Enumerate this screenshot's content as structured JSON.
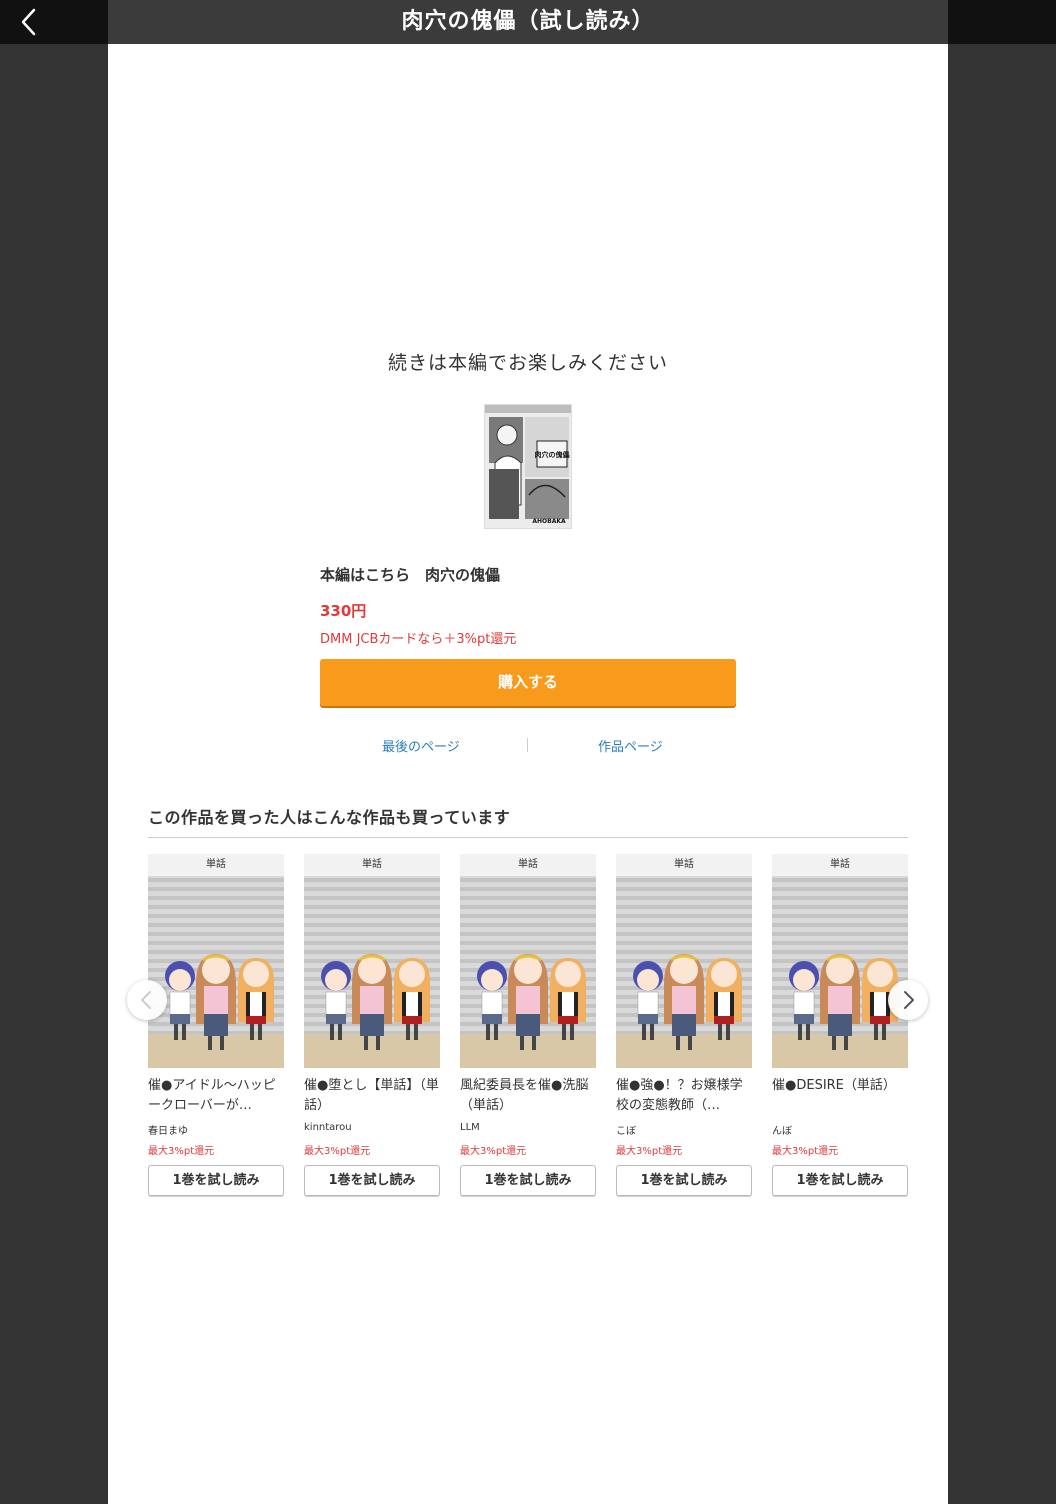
{
  "header": {
    "title": "肉穴の傀儡（試し読み）",
    "back_icon": "chevron-left-icon"
  },
  "main": {
    "continue_message": "続きは本編でお楽しみください",
    "cover_credit": "AHOBAKA",
    "cover_title_text": "肉穴の傀儡",
    "buy_title": "本編はこちら　肉穴の傀儡",
    "price": "330円",
    "jcb_note": "DMM JCBカードなら＋3%pt還元",
    "buy_button": "購入する",
    "last_page_link": "最後のページ",
    "work_page_link": "作品ページ"
  },
  "recommendations": {
    "heading": "この作品を買った人はこんな作品も買っています",
    "items": [
      {
        "tag": "単話",
        "title": "催●アイドル〜ハッピークローバーが…",
        "author": "春日まゆ",
        "points": "最大3%pt還元",
        "button": "1巻を試し読み"
      },
      {
        "tag": "単話",
        "title": "催●堕とし【単話】（単話）",
        "author": "kinntarou",
        "points": "最大3%pt還元",
        "button": "1巻を試し読み"
      },
      {
        "tag": "単話",
        "title": "風紀委員長を催●洗脳（単話）",
        "author": "LLM",
        "points": "最大3%pt還元",
        "button": "1巻を試し読み"
      },
      {
        "tag": "単話",
        "title": "催●強●！？お嬢様学校の変態教師（…",
        "author": "こぼ",
        "points": "最大3%pt還元",
        "button": "1巻を試し読み"
      },
      {
        "tag": "単話",
        "title": "催●DESIRE（単話）",
        "author": "んぼ",
        "points": "最大3%pt還元",
        "button": "1巻を試し読み"
      }
    ],
    "prev_icon": "chevron-left-icon",
    "next_icon": "chevron-right-icon"
  },
  "colors": {
    "accent": "#f89b1c",
    "price_red": "#e03a3a",
    "link_blue": "#2a7fb8"
  }
}
